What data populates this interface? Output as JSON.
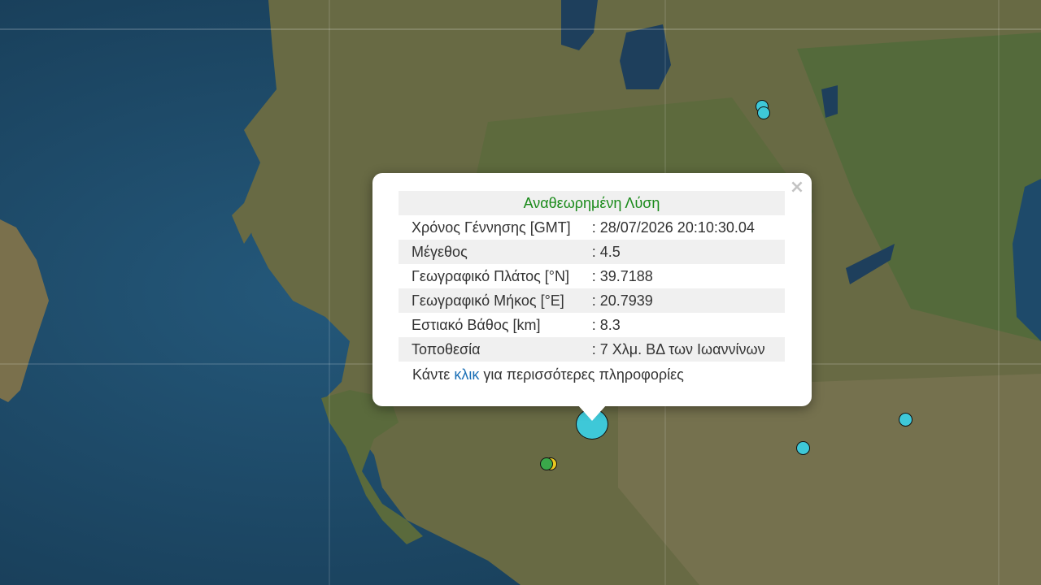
{
  "popup": {
    "title": "Αναθεωρημένη Λύση",
    "close_symbol": "×",
    "rows": [
      {
        "label": "Χρόνος Γέννησης [GMT]",
        "value": ": 28/07/2026 20:10:30.04"
      },
      {
        "label": "Μέγεθος",
        "value": ": 4.5"
      },
      {
        "label": "Γεωγραφικό Πλάτος [°N]",
        "value": ": 39.7188"
      },
      {
        "label": "Γεωγραφικό Μήκος [°E]",
        "value": ": 20.7939"
      },
      {
        "label": "Εστιακό Βάθος [km]",
        "value": ": 8.3"
      },
      {
        "label": "Τοποθεσία",
        "value": ": 7 Χλμ. ΒΔ των Ιωαννίνων"
      }
    ],
    "more_prefix": "Κάντε ",
    "more_link": "κλικ",
    "more_suffix": " για περισσότερες πληροφορίες"
  },
  "colors": {
    "sea": "#1f4a66",
    "land": "#6b6a45",
    "marker_cyan": "#3ec8d8",
    "marker_green": "#3aa84a",
    "marker_yellow": "#e8c820",
    "title_green": "#1a8a1a",
    "link_blue": "#1a6fb6"
  },
  "markers": [
    {
      "name": "main-event-marker",
      "color": "cyan"
    },
    {
      "name": "event-marker-northeast-1",
      "color": "cyan"
    },
    {
      "name": "event-marker-northeast-2",
      "color": "cyan"
    },
    {
      "name": "event-marker-east-1",
      "color": "cyan"
    },
    {
      "name": "event-marker-east-2",
      "color": "cyan"
    },
    {
      "name": "event-marker-southwest-yellow",
      "color": "yellow"
    },
    {
      "name": "event-marker-southwest-green",
      "color": "green"
    }
  ]
}
